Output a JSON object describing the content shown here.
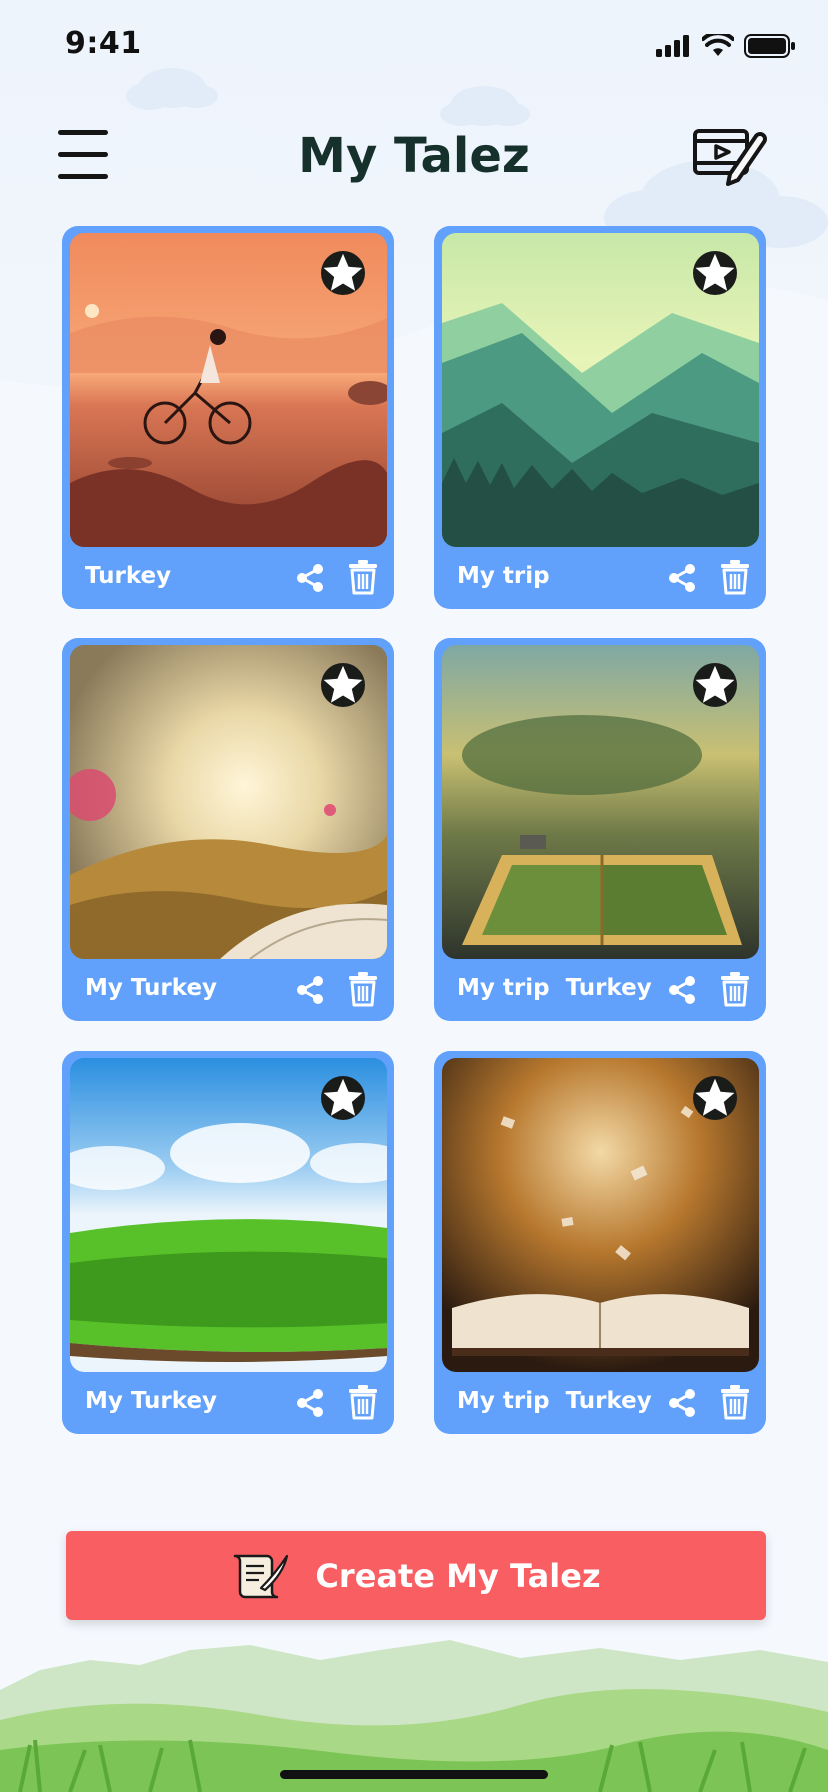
{
  "status_bar": {
    "time": "9:41"
  },
  "header": {
    "title": "My Talez"
  },
  "icons": {
    "menu": "hamburger-menu-icon",
    "editor": "video-edit-icon",
    "favorite": "star-icon",
    "share": "share-icon",
    "delete": "trash-icon",
    "create": "scroll-quill-icon"
  },
  "cards": [
    {
      "title": "Turkey",
      "image": "cyclist-sunset"
    },
    {
      "title": "My trip",
      "image": "green-mountains"
    },
    {
      "title": "My Turkey",
      "image": "book-sunlight-field"
    },
    {
      "title": "My trip  Turkey",
      "image": "book-landscape"
    },
    {
      "title": "My Turkey",
      "image": "green-grass-sky"
    },
    {
      "title": "My trip  Turkey",
      "image": "magic-book"
    }
  ],
  "cta": {
    "label": "Create My Talez"
  },
  "colors": {
    "card": "#61a0fb",
    "cta": "#f95f62",
    "title": "#16302b"
  }
}
